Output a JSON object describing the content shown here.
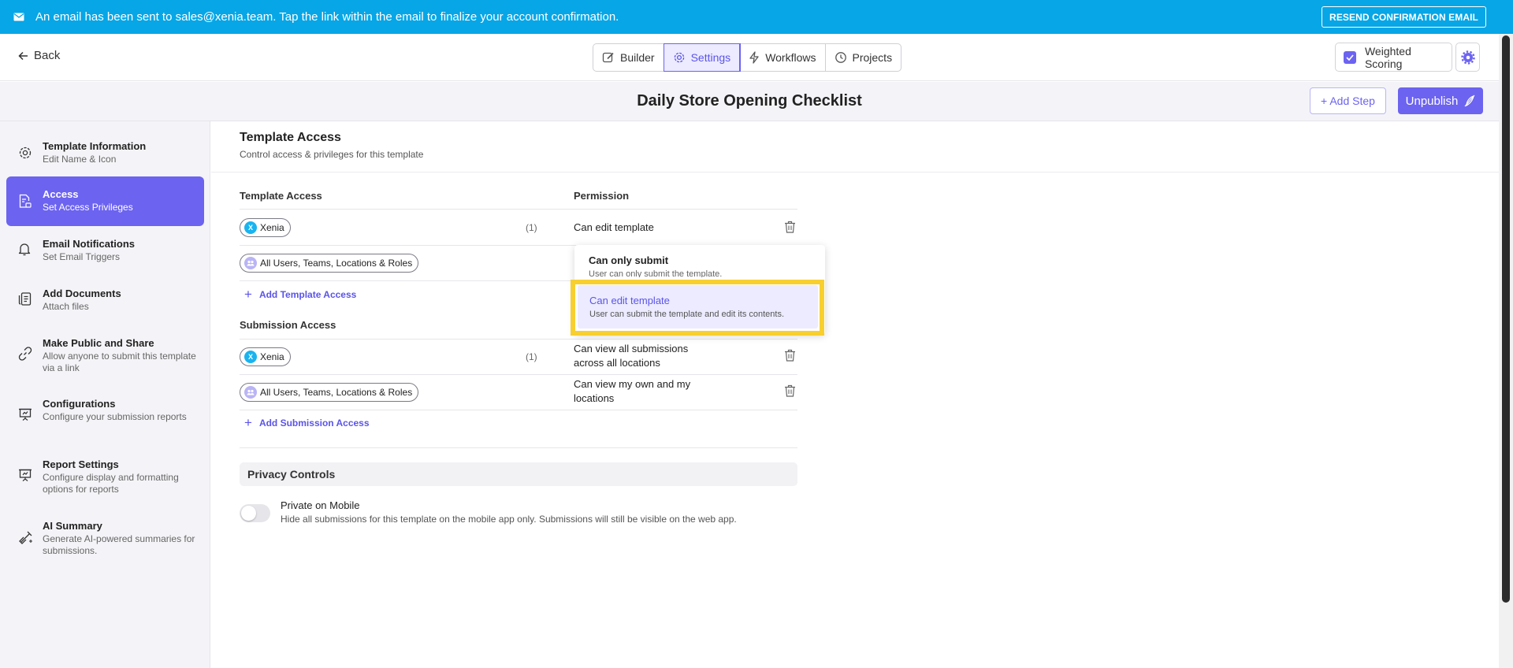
{
  "banner": {
    "message": "An email has been sent to sales@xenia.team. Tap the link within the email to finalize your account confirmation.",
    "resend_label": "RESEND CONFIRMATION EMAIL"
  },
  "topbar": {
    "back_label": "Back",
    "tabs": [
      {
        "label": "Builder",
        "icon": "pencil-icon"
      },
      {
        "label": "Settings",
        "icon": "gear-icon",
        "active": true
      },
      {
        "label": "Workflows",
        "icon": "lightning-icon"
      },
      {
        "label": "Projects",
        "icon": "clock-icon"
      }
    ],
    "weighted_scoring_label": "Weighted Scoring",
    "weighted_scoring_checked": true
  },
  "titlebar": {
    "title": "Daily Store Opening Checklist",
    "add_step_label": "+ Add Step",
    "unpublish_label": "Unpublish"
  },
  "sidebar": {
    "items": [
      {
        "title": "Template Information",
        "sub": "Edit Name & Icon",
        "icon": "gear-icon"
      },
      {
        "title": "Access",
        "sub": "Set Access Privileges",
        "icon": "document-lock-icon",
        "active": true
      },
      {
        "title": "Email Notifications",
        "sub": "Set Email Triggers",
        "icon": "bell-icon"
      },
      {
        "title": "Add Documents",
        "sub": "Attach files",
        "icon": "documents-icon"
      },
      {
        "title": "Make Public and Share",
        "sub": "Allow anyone to submit this template via a link",
        "icon": "link-icon"
      },
      {
        "title": "Configurations",
        "sub": "Configure your submission reports",
        "icon": "presentation-icon"
      },
      {
        "title": "Report Settings",
        "sub": "Configure display and formatting options for reports",
        "icon": "presentation-icon"
      },
      {
        "title": "AI Summary",
        "sub": "Generate AI-powered summaries for submissions.",
        "icon": "sparkle-icon"
      }
    ]
  },
  "main": {
    "section_title": "Template Access",
    "section_sub": "Control access & privileges for this template",
    "template_access": {
      "col_access": "Template Access",
      "col_permission": "Permission",
      "rows": [
        {
          "chip": "Xenia",
          "avatar": "X",
          "count": "(1)",
          "permission": "Can edit template"
        },
        {
          "chip": "All Users, Teams, Locations & Roles",
          "count": "",
          "permission": ""
        }
      ],
      "add_label": "Add Template Access"
    },
    "submission_access": {
      "title": "Submission Access",
      "rows": [
        {
          "chip": "Xenia",
          "avatar": "X",
          "count": "(1)",
          "permission_line1": "Can view all submissions",
          "permission_line2": "across all locations"
        },
        {
          "chip": "All Users, Teams, Locations & Roles",
          "count": "",
          "permission_line1": "Can view my own and my",
          "permission_line2": "locations"
        }
      ],
      "add_label": "Add Submission Access"
    },
    "privacy": {
      "title": "Privacy Controls",
      "toggle_label": "Private on Mobile",
      "toggle_on": false,
      "toggle_desc": "Hide all submissions for this template on the mobile app only. Submissions will still be visible on the web app."
    }
  },
  "dropdown": {
    "options": [
      {
        "title": "Can only submit",
        "sub": "User can only submit the template."
      },
      {
        "title": "Can edit template",
        "sub": "User can submit the template and edit its contents.",
        "selected": true
      }
    ]
  },
  "colors": {
    "accent": "#6c63f0",
    "banner": "#07a6e6",
    "highlight": "#f7cf2f"
  }
}
